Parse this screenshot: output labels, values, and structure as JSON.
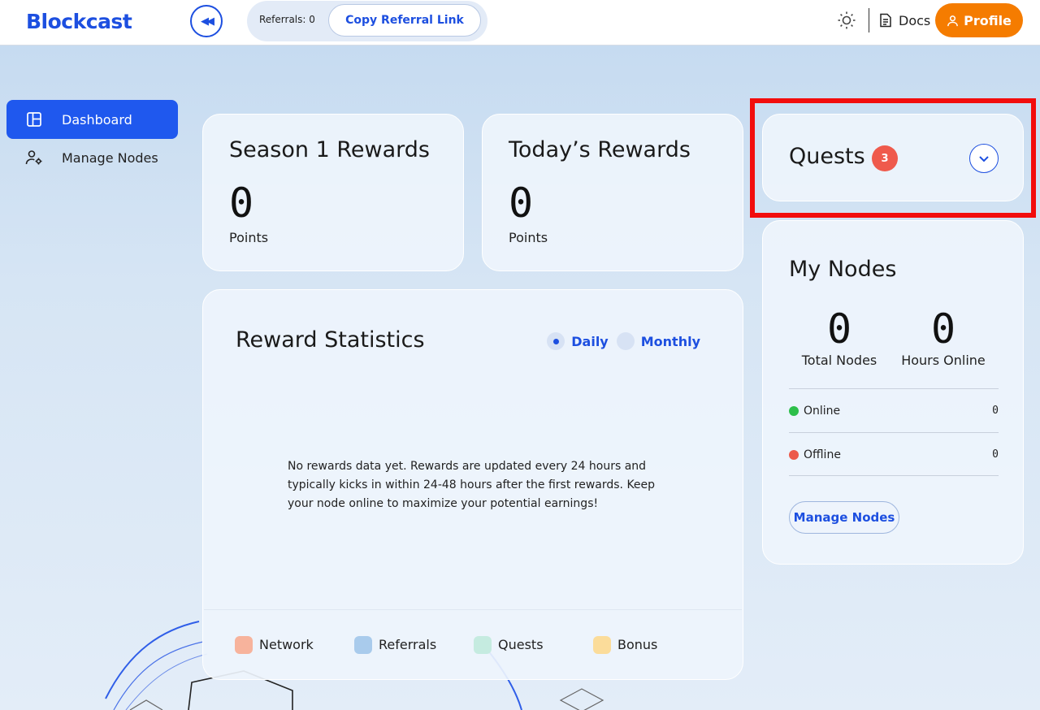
{
  "header": {
    "logo": "Blockcast",
    "referrals_label": "Referrals: 0",
    "copy_referral_label": "Copy Referral Link",
    "docs_label": "Docs",
    "profile_label": "Profile"
  },
  "sidebar": {
    "items": [
      {
        "label": "Dashboard",
        "icon": "dashboard-icon",
        "active": true
      },
      {
        "label": "Manage Nodes",
        "icon": "user-gear-icon",
        "active": false
      }
    ]
  },
  "season_rewards": {
    "title": "Season 1 Rewards",
    "value": "0",
    "unit": "Points"
  },
  "today_rewards": {
    "title": "Today’s Rewards",
    "value": "0",
    "unit": "Points"
  },
  "reward_statistics": {
    "title": "Reward Statistics",
    "periods": [
      {
        "label": "Daily",
        "selected": true
      },
      {
        "label": "Monthly",
        "selected": false
      }
    ],
    "empty_message": "No rewards data yet. Rewards are updated every 24 hours and typically kicks in within 24-48 hours after the first rewards. Keep your node online to maximize your potential earnings!",
    "legend": [
      {
        "label": "Network",
        "color": "#f7b39c"
      },
      {
        "label": "Referrals",
        "color": "#a9cbec"
      },
      {
        "label": "Quests",
        "color": "#c5ebe0"
      },
      {
        "label": "Bonus",
        "color": "#fbdc9a"
      }
    ]
  },
  "quests": {
    "title": "Quests",
    "count": "3"
  },
  "my_nodes": {
    "title": "My Nodes",
    "total_nodes": {
      "value": "0",
      "label": "Total Nodes"
    },
    "hours_online": {
      "value": "0",
      "label": "Hours Online"
    },
    "status": [
      {
        "label": "Online",
        "value": "0",
        "color": "#2dbf4a"
      },
      {
        "label": "Offline",
        "value": "0",
        "color": "#ec5a4b"
      }
    ],
    "manage_label": "Manage Nodes"
  },
  "colors": {
    "accent": "#1d4fe0",
    "profile": "#f57c00",
    "highlight": "#f20d0d"
  }
}
